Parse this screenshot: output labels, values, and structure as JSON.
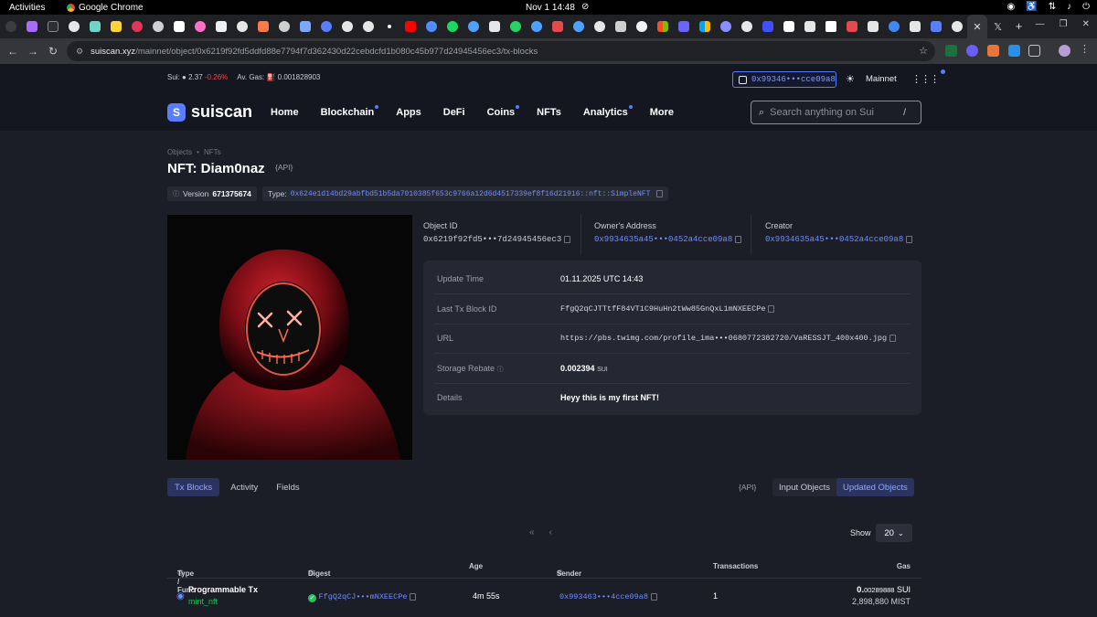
{
  "os": {
    "activities": "Activities",
    "app_name": "Google Chrome",
    "clock": "Nov 1  14:48"
  },
  "browser": {
    "url_host": "suiscan.xyz",
    "url_path": "/mainnet/object/0x6219f92fd5ddfd88e7794f7d362430d22cebdcfd1b080c45b977d24945456ec3/tx-blocks"
  },
  "topbar": {
    "sui_label": "Sui:",
    "sui_price": "2.37",
    "sui_change": "-0.26%",
    "gas_label": "Av. Gas:",
    "gas_value": "0.001828903",
    "wallet": "0x99346•••cce09a8",
    "network": "Mainnet"
  },
  "header": {
    "logo": "suiscan",
    "nav": [
      "Home",
      "Blockchain",
      "Apps",
      "DeFi",
      "Coins",
      "NFTs",
      "Analytics",
      "More"
    ],
    "search_placeholder": "Search anything on Sui",
    "search_shortcut": "/"
  },
  "page": {
    "breadcrumb": [
      "Objects",
      "NFTs"
    ],
    "title": "NFT: Diam0naz",
    "api": "{API}",
    "version_label": "Version",
    "version_value": "671375674",
    "type_label": "Type:",
    "type_value": "0x624e1d14bd29abfbd51b5da7010385f653c9766a12d6d4517339ef8f16d21916::nft::SimpleNFT"
  },
  "object": {
    "object_id_label": "Object ID",
    "object_id": "0x6219f92fd5•••7d24945456ec3",
    "owner_label": "Owner's Address",
    "owner": "0x9934635a45•••0452a4cce09a8",
    "creator_label": "Creator",
    "creator": "0x9934635a45•••0452a4cce09a8"
  },
  "details": {
    "update_time_label": "Update Time",
    "update_time": "01.11.2025 UTC 14:43",
    "last_tx_label": "Last Tx Block ID",
    "last_tx": "FfgQ2qCJTTtfF84VT1C9HuHn2tWw85GnQxL1mNXEECPe",
    "url_label": "URL",
    "url": "https://pbs.twimg.com/profile_ima•••0680772382720/VaRESSJT_400x400.jpg",
    "rebate_label": "Storage Rebate",
    "rebate_value": "0.002394",
    "rebate_unit": "SUI",
    "details_label": "Details",
    "details_value": "Heyy this is my first NFT!"
  },
  "tabs": {
    "items": [
      "Tx Blocks",
      "Activity",
      "Fields"
    ],
    "api": "{API}",
    "toggle": [
      "Input Objects",
      "Updated Objects"
    ],
    "show_label": "Show",
    "show_value": "20"
  },
  "table": {
    "headers": [
      "Type / Func",
      "Digest",
      "Age",
      "Sender",
      "Transactions",
      "Gas"
    ],
    "rows": [
      {
        "type": "Programmable Tx",
        "func": "mint_nft",
        "digest": "FfgQ2qCJ•••mNXEECPe",
        "age": "4m 55s",
        "sender": "0x993463•••4cce09a8",
        "transactions": "1",
        "gas_big": "0.",
        "gas_small": "00289888",
        "gas_unit": "SUI",
        "gas_mist": "2,898,880 MIST"
      }
    ]
  }
}
